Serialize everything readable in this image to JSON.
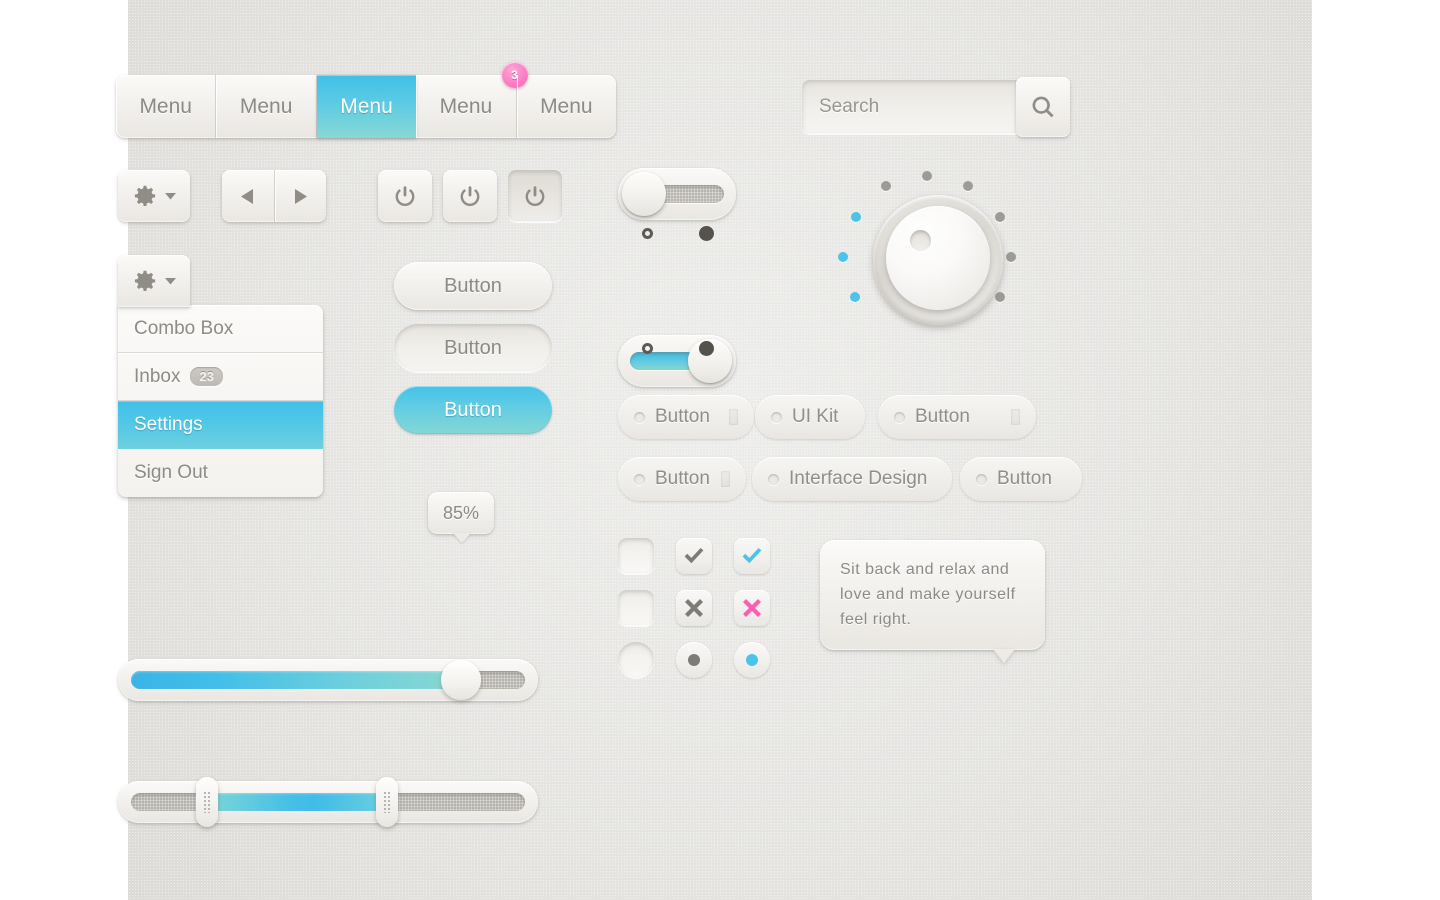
{
  "theme": {
    "accent_blue": "#4cc3e8",
    "accent_teal": "#85d7d5",
    "accent_pink": "#f268b6",
    "text_gray": "#8d8a85",
    "surface": "#f3f1ee",
    "canvas": "#e6e5e2"
  },
  "menubar": {
    "items": [
      {
        "label": "Menu",
        "state": "normal"
      },
      {
        "label": "Menu",
        "state": "normal"
      },
      {
        "label": "Menu",
        "state": "active"
      },
      {
        "label": "Menu",
        "state": "normal",
        "badge": "3"
      },
      {
        "label": "Menu",
        "state": "normal"
      }
    ]
  },
  "search": {
    "placeholder": "Search",
    "value": "",
    "button_icon": "search-icon"
  },
  "toolbar": {
    "gear_button": {
      "icon": "gear-icon",
      "caret": "chevron-down-icon"
    },
    "nav": {
      "prev_icon": "triangle-left-icon",
      "next_icon": "triangle-right-icon"
    },
    "power_buttons": [
      {
        "icon": "power-icon",
        "state": "normal"
      },
      {
        "icon": "power-icon",
        "state": "normal"
      },
      {
        "icon": "power-icon",
        "state": "pressed"
      }
    ]
  },
  "dropdown": {
    "trigger": {
      "icon": "gear-icon",
      "caret": "chevron-down-icon"
    },
    "items": [
      {
        "label": "Combo Box",
        "state": "normal"
      },
      {
        "label": "Inbox",
        "state": "normal",
        "count": "23"
      },
      {
        "label": "Settings",
        "state": "selected"
      },
      {
        "label": "Sign Out",
        "state": "normal"
      }
    ]
  },
  "buttons": [
    {
      "label": "Button",
      "state": "normal"
    },
    {
      "label": "Button",
      "state": "pressed"
    },
    {
      "label": "Button",
      "state": "active"
    }
  ],
  "toggles": [
    {
      "state": "off",
      "off_icon": "circle-outline-icon",
      "on_icon": "circle-filled-icon"
    },
    {
      "state": "on",
      "off_icon": "circle-outline-icon",
      "on_icon": "circle-filled-icon"
    }
  ],
  "knob": {
    "name": "rotary-knob",
    "ticks_total": 12,
    "ticks_active": 3,
    "active_color": "#4cc3e8",
    "inactive_color": "#9e9b95"
  },
  "tags": [
    {
      "label": "Button"
    },
    {
      "label": "UI Kit"
    },
    {
      "label": "Button"
    },
    {
      "label": "Button"
    },
    {
      "label": "Interface Design"
    },
    {
      "label": "Button"
    }
  ],
  "controls_grid": {
    "rows": [
      {
        "type": "checkbox",
        "cells": [
          {
            "state": "unchecked",
            "mark": "none"
          },
          {
            "state": "checked",
            "mark": "check-icon",
            "color": "#7f7c77"
          },
          {
            "state": "checked",
            "mark": "check-icon",
            "color": "#4cc3e8"
          }
        ]
      },
      {
        "type": "checkbox",
        "cells": [
          {
            "state": "unchecked",
            "mark": "none"
          },
          {
            "state": "checked",
            "mark": "cross-icon",
            "color": "#7f7c77"
          },
          {
            "state": "checked",
            "mark": "cross-icon",
            "color": "#fb5fb4"
          }
        ]
      },
      {
        "type": "radio",
        "cells": [
          {
            "state": "unchecked",
            "mark": "none"
          },
          {
            "state": "checked",
            "mark": "dot-icon",
            "color": "#7f7c77"
          },
          {
            "state": "checked",
            "mark": "dot-icon",
            "color": "#4cc3e8"
          }
        ]
      }
    ]
  },
  "slider": {
    "value_label": "85%",
    "value": 85,
    "min": 0,
    "max": 100
  },
  "range_slider": {
    "low": 19,
    "high": 63,
    "min": 0,
    "max": 100
  },
  "tooltip": {
    "text": "Sit back and relax and love and make yourself feel right."
  }
}
